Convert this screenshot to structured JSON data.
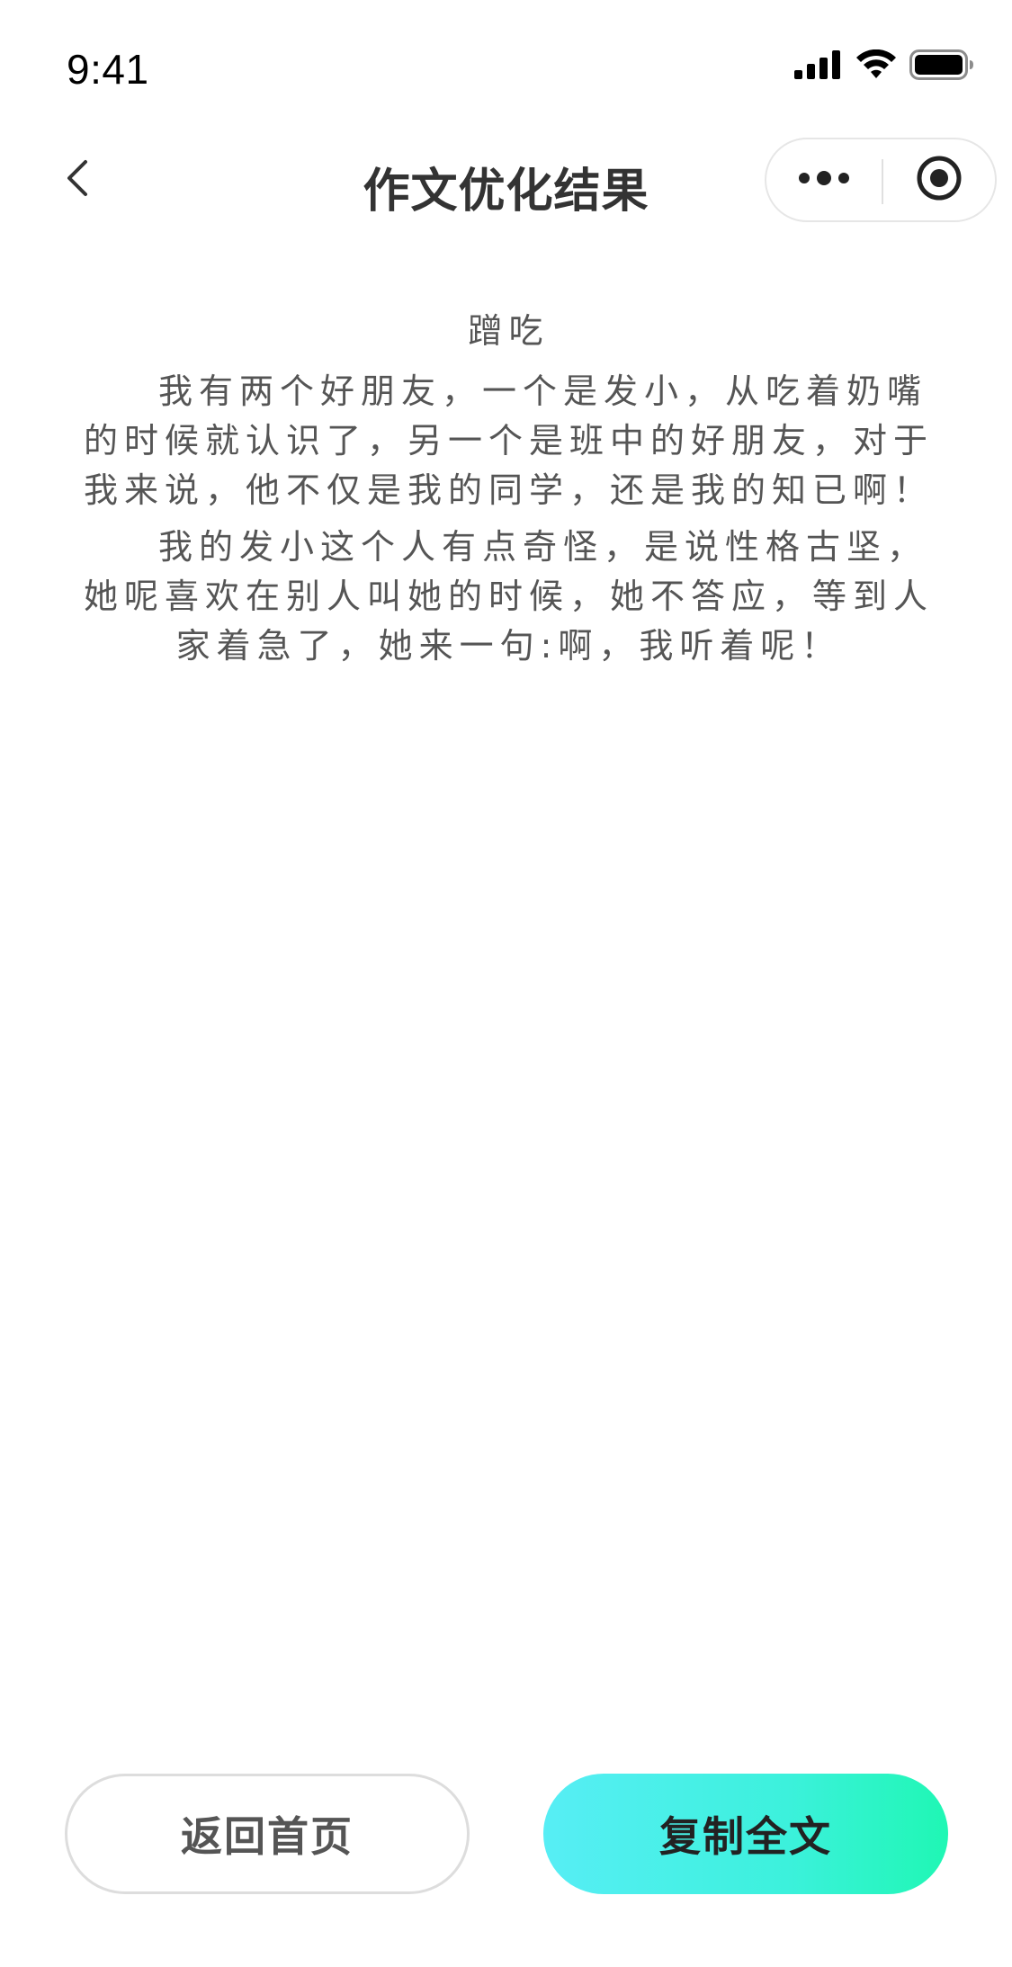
{
  "status_bar": {
    "time": "9:41",
    "icons": [
      "signal-icon",
      "wifi-icon",
      "battery-icon"
    ]
  },
  "nav": {
    "title": "作文优化结果",
    "back_icon": "chevron-left-icon",
    "more_icon": "more-dots-icon",
    "close_icon": "target-close-icon"
  },
  "essay": {
    "title": "蹭吃",
    "paragraphs": [
      "我有两个好朋友，一个是发小，从吃着奶嘴的时候就认识了，另一个是班中的好朋友，对于我来说，他不仅是我的同学，还是我的知已啊！",
      "我的发小这个人有点奇怪，是说性格古坚，她呢喜欢在别人叫她的时候，她不答应，等到人家着急了，她来一句:啊，我听着呢！"
    ]
  },
  "buttons": {
    "home_label": "返回首页",
    "copy_label": "复制全文"
  },
  "colors": {
    "copy_gradient_start": "#57eef5",
    "copy_gradient_end": "#1ff7b4",
    "text": "#555555",
    "title": "#333333"
  }
}
